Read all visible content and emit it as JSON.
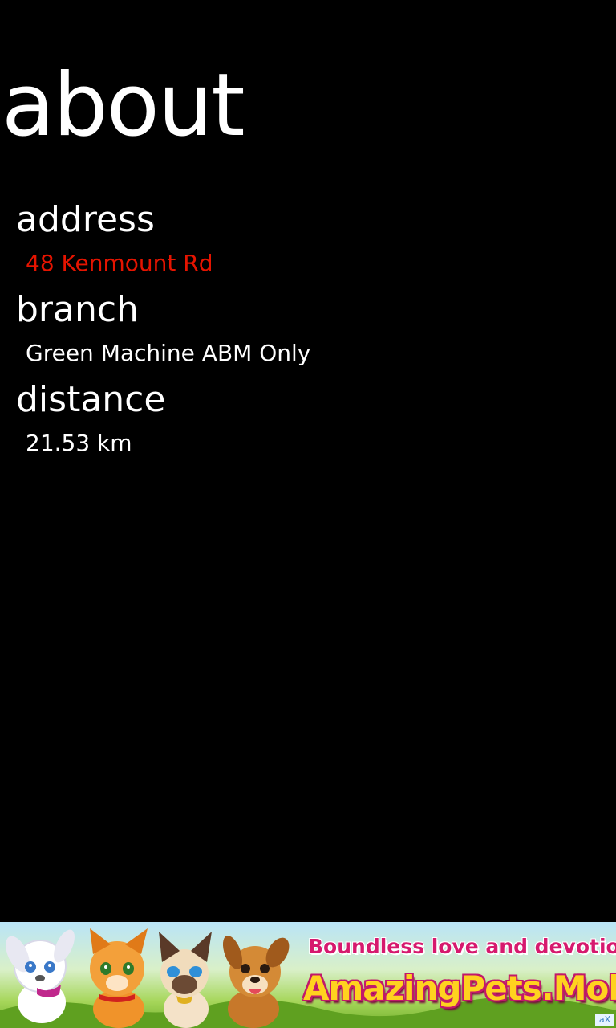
{
  "page": {
    "title": "about"
  },
  "fields": {
    "address": {
      "label": "address",
      "value": "48 Kenmount Rd"
    },
    "branch": {
      "label": "branch",
      "value": "Green Machine ABM Only"
    },
    "distance": {
      "label": "distance",
      "value": "21.53 km"
    }
  },
  "ad": {
    "headline": "Boundless love and devotion!",
    "brand": "AmazingPets.Mobi",
    "choice_icon_label": "aX",
    "icons": [
      "white-puppy-icon",
      "orange-kitten-icon",
      "siamese-cat-icon",
      "brown-puppy-icon"
    ]
  },
  "colors": {
    "background": "#000000",
    "text": "#ffffff",
    "accent": "#e51400"
  }
}
